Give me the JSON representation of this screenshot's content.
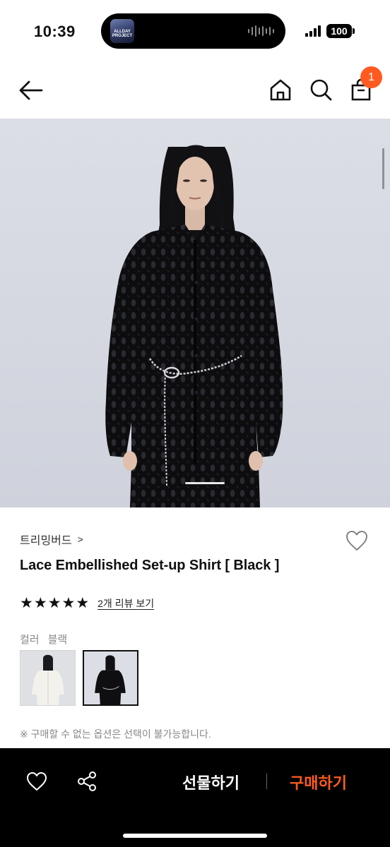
{
  "status_bar": {
    "time": "10:39",
    "now_playing_art_text": "ALLDAY PROJECT",
    "battery": "100"
  },
  "nav": {
    "back_icon": "arrow-left-icon",
    "home_icon": "home-icon",
    "search_icon": "search-icon",
    "cart_icon": "shopping-bag-icon",
    "cart_badge": "1"
  },
  "product": {
    "brand": "트리밍버드",
    "brand_chevron": ">",
    "title": "Lace Embellished Set-up Shirt [ Black ]",
    "rating_stars": 5,
    "review_link": "2개 리뷰 보기",
    "option_label": "컬러",
    "option_value": "블랙",
    "swatches": [
      {
        "name": "white",
        "selected": false
      },
      {
        "name": "black",
        "selected": true
      }
    ],
    "notice": "※ 구매할 수 없는 옵션은 선택이 불가능합니다."
  },
  "bottom_bar": {
    "heart_icon": "heart-icon",
    "share_icon": "share-icon",
    "gift_label": "선물하기",
    "buy_label": "구매하기"
  },
  "colors": {
    "accent": "#ff5a1f",
    "bottom_bar_bg": "#000000",
    "hero_bg": "#d7dae3"
  }
}
